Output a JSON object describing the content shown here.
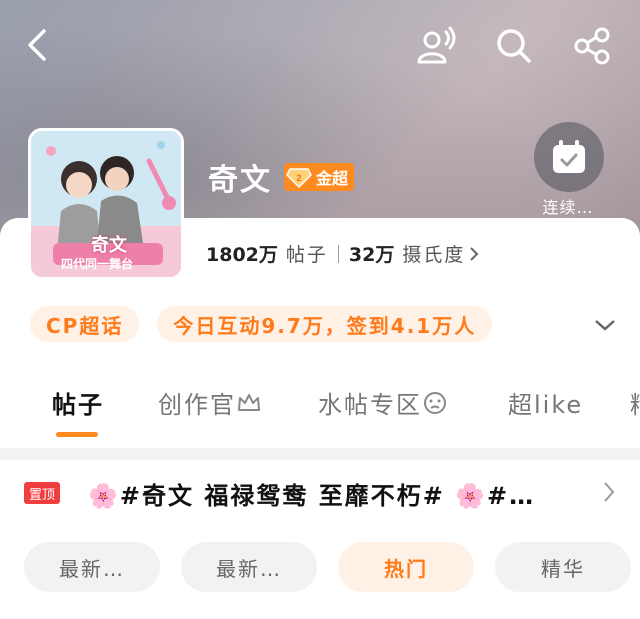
{
  "header": {
    "back_icon": "chevron-left-icon",
    "actions": [
      "profile-sound-icon",
      "search-icon",
      "share-icon"
    ]
  },
  "topic": {
    "name": "奇文",
    "level_badge": "金超",
    "checkin_label": "连续…",
    "posts_count": "1802万",
    "posts_label": "帖子",
    "reads_count": "32万",
    "reads_label": "摄氏度",
    "avatar_text": "奇文",
    "avatar_subtitle": "四代同一舞台"
  },
  "tags": {
    "cp": "CP超话",
    "daily": "今日互动9.7万，签到4.1万人"
  },
  "tabs": [
    {
      "label": "帖子",
      "active": true
    },
    {
      "label": "创作官",
      "active": false
    },
    {
      "label": "水帖专区",
      "active": false
    },
    {
      "label": "超like",
      "active": false
    },
    {
      "label": "精",
      "active": false
    }
  ],
  "pinned": {
    "badge": "置顶",
    "text": "🌸#奇文 福禄鸳鸯 至靡不朽# 🌸#…"
  },
  "filters": [
    "最新…",
    "最新…",
    "热门",
    "精华"
  ],
  "colors": {
    "accent": "#ff8a1f",
    "pin_red": "#f03e3e"
  }
}
